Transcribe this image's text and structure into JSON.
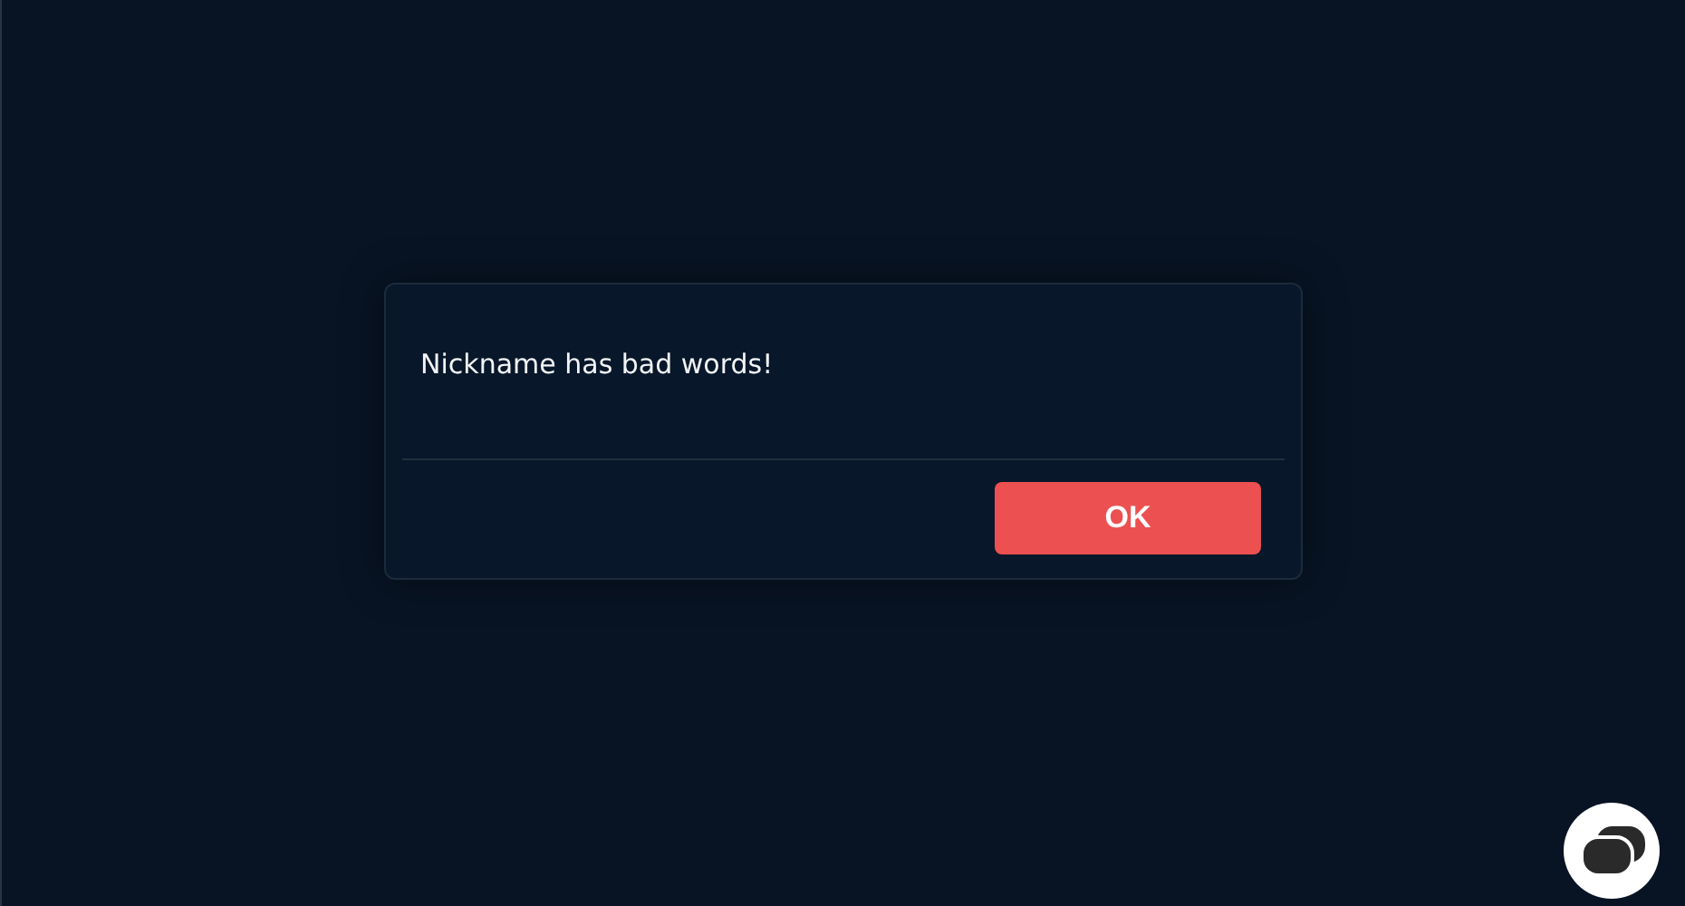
{
  "dialog": {
    "message": "Nickname has bad words!",
    "buttons": [
      "OK"
    ]
  }
}
